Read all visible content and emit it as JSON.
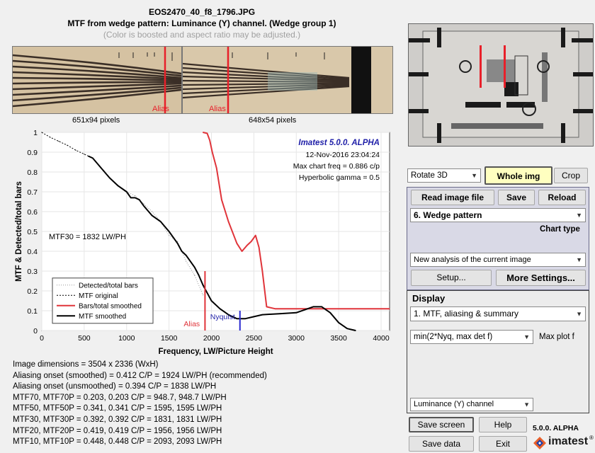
{
  "header": {
    "filename": "EOS2470_40_f8_1796.JPG",
    "subtitle": "MTF from wedge pattern:  Luminance (Y) channel.  (Wedge group 1)",
    "note": "(Color is boosted and aspect ratio may be adjusted.)"
  },
  "images": {
    "left": {
      "size_label": "651x94 pixels",
      "alias_label": "Alias"
    },
    "right": {
      "size_label": "648x54 pixels",
      "alias_label": "Alias"
    }
  },
  "chart_data": {
    "type": "line",
    "title": "",
    "xlabel": "Frequency, LW/Picture Height",
    "ylabel": "MTF & Detected/total bars",
    "xlim": [
      0,
      4100
    ],
    "ylim": [
      0,
      1
    ],
    "xticks": [
      "0",
      "500",
      "1000",
      "1500",
      "2000",
      "2500",
      "3000",
      "3500",
      "4000"
    ],
    "yticks": [
      "0",
      "0.1",
      "0.2",
      "0.3",
      "0.4",
      "0.5",
      "0.6",
      "0.7",
      "0.8",
      "0.9",
      "1"
    ],
    "grid": true,
    "legend_position": "lower-left",
    "annotations": {
      "brand": "Imatest 5.0.0. ALPHA",
      "date": "12-Nov-2016 23:04:24",
      "max_freq": "Max chart freq = 0.886 c/p",
      "gamma": "Hyperbolic gamma = 0.5",
      "mtf30": "MTF30 = 1832 LW/PH",
      "alias": "Alias",
      "nyquist": "Nyquist"
    },
    "markers": {
      "alias_x": 1924,
      "nyquist_x": 2336
    },
    "series": [
      {
        "name": "Detected/total bars",
        "color": "#999999",
        "style": "dotted",
        "x": [
          1000,
          1100,
          1200,
          1300,
          1400,
          1500,
          1600,
          1700,
          1800,
          1900
        ],
        "y": [
          0.7,
          0.68,
          0.64,
          0.6,
          0.55,
          0.48,
          0.45,
          0.35,
          0.28,
          0.18
        ]
      },
      {
        "name": "MTF original",
        "color": "#000000",
        "style": "dotted-thin",
        "x": [
          0,
          100,
          200,
          300,
          400,
          500,
          550
        ],
        "y": [
          1.0,
          0.975,
          0.955,
          0.935,
          0.91,
          0.89,
          0.88
        ]
      },
      {
        "name": "Bars/total smoothed",
        "color": "#e0343a",
        "style": "solid",
        "x": [
          1900,
          1950,
          1980,
          2010,
          2060,
          2120,
          2200,
          2300,
          2360,
          2420,
          2470,
          2520,
          2560,
          2600,
          2650,
          2750,
          3000,
          3300,
          3600,
          4100
        ],
        "y": [
          1.0,
          0.995,
          0.96,
          0.9,
          0.82,
          0.66,
          0.55,
          0.44,
          0.4,
          0.43,
          0.45,
          0.48,
          0.42,
          0.3,
          0.12,
          0.11,
          0.11,
          0.11,
          0.11,
          0.11
        ]
      },
      {
        "name": "MTF smoothed",
        "color": "#000000",
        "style": "solid",
        "x": [
          550,
          600,
          700,
          800,
          900,
          1000,
          1050,
          1100,
          1150,
          1200,
          1300,
          1400,
          1500,
          1600,
          1650,
          1700,
          1800,
          1850,
          1900,
          1950,
          2000,
          2100,
          2200,
          2300,
          2400,
          2500,
          2600,
          2800,
          3000,
          3200,
          3300,
          3400,
          3500,
          3600,
          3700
        ],
        "y": [
          0.88,
          0.87,
          0.82,
          0.77,
          0.73,
          0.7,
          0.67,
          0.67,
          0.66,
          0.63,
          0.58,
          0.55,
          0.5,
          0.44,
          0.4,
          0.38,
          0.32,
          0.28,
          0.23,
          0.19,
          0.15,
          0.11,
          0.08,
          0.06,
          0.06,
          0.07,
          0.08,
          0.085,
          0.09,
          0.12,
          0.12,
          0.09,
          0.04,
          0.01,
          0.0
        ]
      }
    ]
  },
  "stats": [
    "Image dimensions = 3504 x 2336 (WxH)",
    "Aliasing onset (smoothed) = 0.412 C/P  = 1924 LW/PH (recommended)",
    "Aliasing onset (unsmoothed) = 0.394 C/P  = 1838 LW/PH",
    "MTF70, MTF70P = 0.203, 0.203 C/P  = 948.7, 948.7 LW/PH",
    "MTF50, MTF50P = 0.341, 0.341 C/P  = 1595, 1595 LW/PH",
    "MTF30, MTF30P = 0.392, 0.392 C/P  = 1831, 1831 LW/PH",
    "MTF20, MTF20P = 0.419, 0.419 C/P  = 1956, 1956 LW/PH",
    "MTF10, MTF10P = 0.448, 0.448 C/P  = 2093, 2093 LW/PH"
  ],
  "controls": {
    "rotate": "Rotate 3D",
    "whole_img": "Whole img",
    "crop": "Crop",
    "read_image": "Read image file",
    "save": "Save",
    "reload": "Reload",
    "chart_type_value": "6. Wedge pattern",
    "chart_type_label": "Chart type",
    "analysis_value": "New analysis of the current image",
    "setup": "Setup...",
    "more_settings": "More Settings...",
    "display_label": "Display",
    "display_value": "1. MTF, aliasing & summary",
    "plot_value": "min(2*Nyq, max det f)",
    "plot_label": "Max plot f",
    "channel_value": "Luminance (Y) channel",
    "save_screen": "Save screen",
    "help": "Help",
    "save_data": "Save data",
    "exit": "Exit",
    "version": "5.0.0. ALPHA",
    "brand": "imatest",
    "registered": "®"
  }
}
